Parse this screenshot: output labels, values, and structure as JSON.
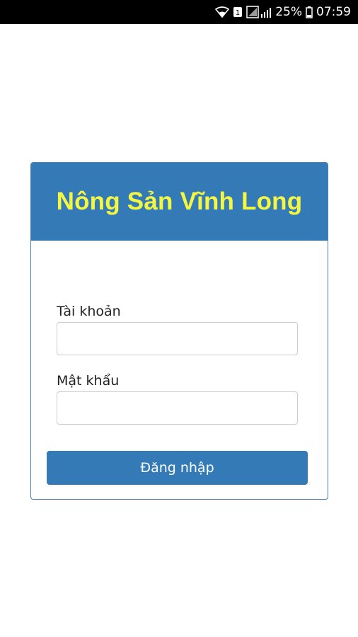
{
  "status_bar": {
    "icons": [
      "wifi-icon",
      "sim-1-icon",
      "signal-icon",
      "battery-icon"
    ],
    "sim_label": "1",
    "battery_percent": "25%",
    "time": "07:59"
  },
  "login_card": {
    "title": "Nông Sản Vĩnh Long",
    "username_label": "Tài khoản",
    "username_value": "",
    "password_label": "Mật khẩu",
    "password_value": "",
    "submit_label": "Đăng nhập"
  },
  "colors": {
    "header_bg": "#337ab7",
    "title_color": "#f4f742",
    "button_bg": "#337ab7",
    "status_bar_bg": "#000000"
  }
}
